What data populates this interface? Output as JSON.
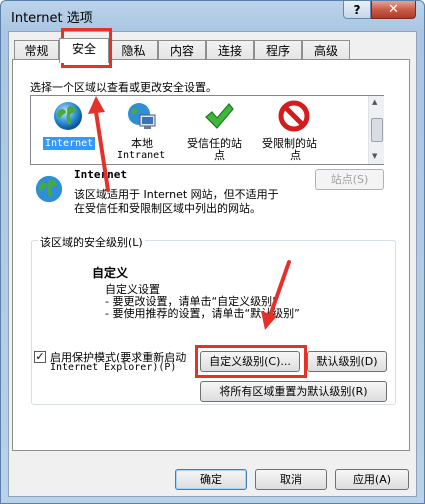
{
  "window": {
    "title": "Internet 选项",
    "help": "?",
    "close": "✕"
  },
  "tabs": [
    "常规",
    "安全",
    "隐私",
    "内容",
    "连接",
    "程序",
    "高级"
  ],
  "security": {
    "prompt": "选择一个区域以查看或更改安全设置。",
    "zones": [
      {
        "name": "Internet",
        "icon": "globe-icon"
      },
      {
        "name_line1": "本地",
        "name_line2": "Intranet",
        "icon": "intranet-icon"
      },
      {
        "name_line1": "受信任的站",
        "name_line2": "点",
        "icon": "checkmark-icon"
      },
      {
        "name_line1": "受限制的站",
        "name_line2": "点",
        "icon": "no-entry-icon"
      }
    ],
    "zone_detail": {
      "title": "Internet",
      "line1": "该区域适用于 Internet 网站，但不适用于",
      "line2": "在受信任和受限制区域中列出的网站。"
    },
    "sites_button": "站点(S)",
    "level_group": {
      "legend": "该区域的安全级别(L)",
      "level_name": "自定义",
      "line1": "自定义设置",
      "line2": "- 要更改设置，请单击“自定义级别”",
      "line3": "- 要使用推荐的设置，请单击“默认级别”"
    },
    "protected_mode": {
      "checked": true,
      "line1": "启用保护模式(要求重新启动",
      "line2": "Internet Explorer)(P)"
    },
    "custom_level_button": "自定义级别(C)...",
    "default_level_button": "默认级别(D)",
    "reset_all_button": "将所有区域重置为默认级别(R)"
  },
  "footer": {
    "ok": "确定",
    "cancel": "取消",
    "apply": "应用(A)"
  },
  "colors": {
    "highlight": "#e4322b",
    "selection": "#3399ff"
  }
}
